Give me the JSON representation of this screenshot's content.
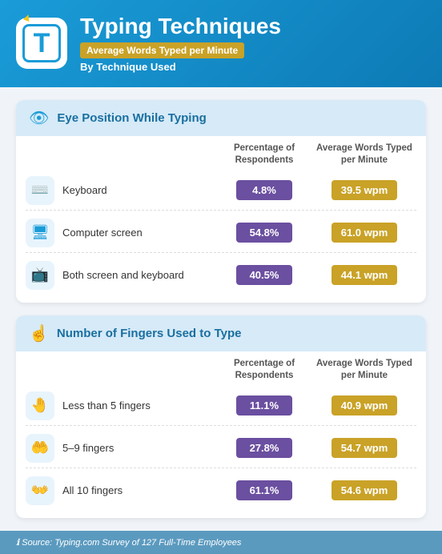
{
  "header": {
    "title": "Typing Techniques",
    "badge": "Average Words Typed per Minute",
    "by_label": "By Technique Used",
    "icon_letter": "T"
  },
  "sections": [
    {
      "id": "eye-position",
      "icon": "👁",
      "title": "Eye Position While Typing",
      "col_pct": "Percentage of Respondents",
      "col_avg": "Average Words Typed per Minute",
      "rows": [
        {
          "icon": "⌨",
          "label": "Keyboard",
          "pct": "4.8%",
          "avg": "39.5 wpm"
        },
        {
          "icon": "🖥",
          "label": "Computer screen",
          "pct": "54.8%",
          "avg": "61.0 wpm"
        },
        {
          "icon": "📺",
          "label": "Both screen and keyboard",
          "pct": "40.5%",
          "avg": "44.1 wpm"
        }
      ]
    },
    {
      "id": "fingers",
      "icon": "☝",
      "title": "Number of Fingers Used to Type",
      "col_pct": "Percentage of Respondents",
      "col_avg": "Average Words Typed per Minute",
      "rows": [
        {
          "icon": "🤚",
          "label": "Less than 5 fingers",
          "pct": "11.1%",
          "avg": "40.9 wpm"
        },
        {
          "icon": "🤲",
          "label": "5–9 fingers",
          "pct": "27.8%",
          "avg": "54.7 wpm"
        },
        {
          "icon": "👐",
          "label": "All 10 fingers",
          "pct": "61.1%",
          "avg": "54.6 wpm"
        }
      ]
    }
  ],
  "footer": {
    "text": "ℹ Source: Typing.com Survey of 127 Full-Time Employees"
  },
  "colors": {
    "purple": "#6b4fa0",
    "gold": "#c9a227",
    "blue": "#1a9cd8"
  }
}
